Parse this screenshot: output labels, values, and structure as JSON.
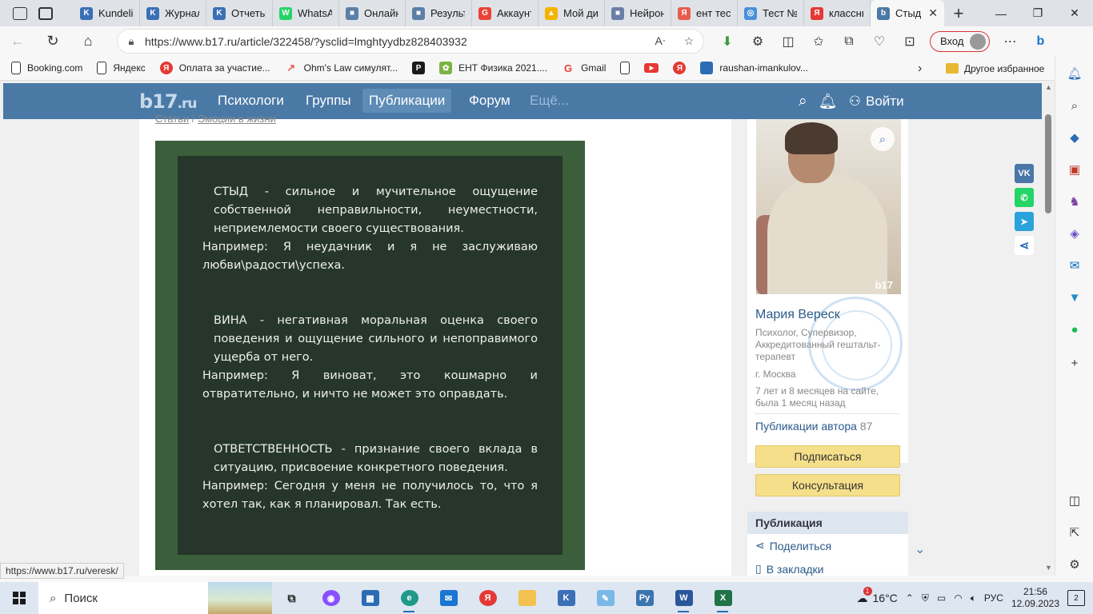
{
  "browser": {
    "tabs": [
      {
        "label": "Kundelik",
        "favicon_color": "#3b6fb6",
        "favicon_text": "K"
      },
      {
        "label": "Журнал",
        "favicon_color": "#3b6fb6",
        "favicon_text": "K"
      },
      {
        "label": "Отчеты",
        "favicon_color": "#3b6fb6",
        "favicon_text": "K"
      },
      {
        "label": "WhatsApp",
        "favicon_color": "#25d366",
        "favicon_text": "W"
      },
      {
        "label": "Онлайн",
        "favicon_color": "#5b7fa6",
        "favicon_text": "■"
      },
      {
        "label": "Результ",
        "favicon_color": "#5b7fa6",
        "favicon_text": "■"
      },
      {
        "label": "Аккаунт",
        "favicon_color": "#ea4335",
        "favicon_text": "G"
      },
      {
        "label": "Мой ди",
        "favicon_color": "#f4b400",
        "favicon_text": "▲"
      },
      {
        "label": "Нейрон",
        "favicon_color": "#6b7fa8",
        "favicon_text": "■"
      },
      {
        "label": "ент тест",
        "favicon_color": "#e85d4e",
        "favicon_text": "Я"
      },
      {
        "label": "Тест №",
        "favicon_color": "#4a90d9",
        "favicon_text": "◎"
      },
      {
        "label": "классны",
        "favicon_color": "#e53935",
        "favicon_text": "Я"
      },
      {
        "label": "Стыд",
        "favicon_color": "#4a79a6",
        "favicon_text": "b"
      }
    ],
    "url": "https://www.b17.ru/article/322458/?ysclid=lmghtyydbz828403932",
    "login_label": "Вход",
    "favorites": [
      {
        "label": "Booking.com",
        "icon": "page-icon",
        "color": "#ffffff",
        "text": ""
      },
      {
        "label": "Яндекс",
        "icon": "page-icon",
        "color": "#ffffff",
        "text": ""
      },
      {
        "label": "Оплата за участие...",
        "icon": "yandex-icon",
        "color": "#e53935",
        "text": "Я"
      },
      {
        "label": "Ohm's Law симулят...",
        "icon": "rocket-icon",
        "color": "#e85d4e",
        "text": "↗"
      },
      {
        "label": "PhET",
        "icon": "phet-icon",
        "color": "#1a1a1a",
        "text": "P"
      },
      {
        "label": "ЕНТ Физика 2021....",
        "icon": "leaf-icon",
        "color": "#7cb342",
        "text": "✿"
      },
      {
        "label": "Gmail",
        "icon": "google-icon",
        "color": "#ea4335",
        "text": "G"
      }
    ],
    "favorites_tail": [
      {
        "label": "",
        "icon": "page-icon"
      },
      {
        "label": "",
        "icon": "youtube-icon"
      },
      {
        "label": "",
        "icon": "yandex-icon"
      },
      {
        "label": "raushan-imankulov...",
        "icon": "book-icon"
      }
    ],
    "other_favorites": "Другое избранное",
    "status_url": "https://www.b17.ru/veresk/"
  },
  "site": {
    "logo": "b17",
    "logo_suffix": ".ru",
    "nav": [
      "Психологи",
      "Группы",
      "Публикации",
      "Форум",
      "Ещё..."
    ],
    "nav_active": "Публикации",
    "login": "Войти",
    "breadcrumb": [
      "Статьи",
      "Эмоции в жизни"
    ]
  },
  "article_image": {
    "blocks": [
      {
        "definition": "СТЫД - сильное и мучительное ощущение собственной неправильности, неуместности, неприемлемости своего существования.",
        "example": "Например: Я неудачник и я не заслуживаю любви\\радости\\успеха."
      },
      {
        "definition": "ВИНА - негативная моральная оценка своего поведения и ощущение сильного и непоправимого ущерба от него.",
        "example": "Например: Я виноват, это кошмарно и отвратительно, и ничто не может это оправдать."
      },
      {
        "definition": "ОТВЕТСТВЕННОСТЬ - признание своего вклада в ситуацию, присвоение конкретного поведения.",
        "example": "Например: Сегодня у меня не получилось то, что я хотел так, как я планировал. Так есть."
      }
    ]
  },
  "author": {
    "name": "Мария Вереск",
    "role": "Психолог, Супервизор, Аккредитованный гештальт-терапевт",
    "city": "г. Москва",
    "since": "7 лет и 8 месяцев на сайте, была 1 месяц назад",
    "publications_label": "Публикации автора",
    "publications_count": "87",
    "subscribe": "Подписаться",
    "consult": "Консультация",
    "photo_watermark": "b17"
  },
  "publication_box": {
    "title": "Публикация",
    "share": "Поделиться",
    "bookmark": "В закладки"
  },
  "share_buttons": [
    {
      "name": "vk",
      "color": "#4a76a8",
      "text": "VK"
    },
    {
      "name": "whatsapp",
      "color": "#25d366",
      "text": "✆"
    },
    {
      "name": "telegram",
      "color": "#2aa3db",
      "text": "➤"
    },
    {
      "name": "share",
      "color": "#ffffff",
      "text": ""
    }
  ],
  "taskbar": {
    "search": "Поиск",
    "temperature": "16°C",
    "language": "РУС",
    "time": "21:56",
    "date": "12.09.2023",
    "notifications": "2",
    "weather_badge": "1"
  }
}
